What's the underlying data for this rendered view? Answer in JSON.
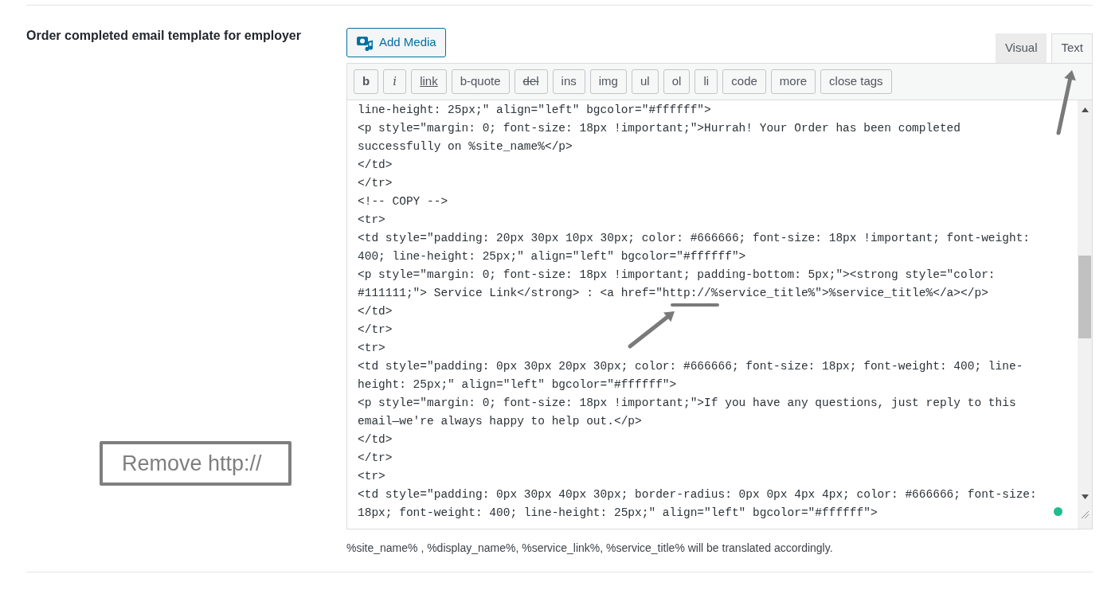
{
  "field": {
    "label": "Order completed email template for employer"
  },
  "add_media": {
    "label": "Add Media"
  },
  "tabs": [
    {
      "label": "Visual",
      "selected": false
    },
    {
      "label": "Text",
      "selected": true
    }
  ],
  "quicktags": [
    {
      "label": "b",
      "kind": "bold"
    },
    {
      "label": "i",
      "kind": "italic"
    },
    {
      "label": "link",
      "kind": "underline"
    },
    {
      "label": "b-quote",
      "kind": "plain"
    },
    {
      "label": "del",
      "kind": "strike"
    },
    {
      "label": "ins",
      "kind": "plain"
    },
    {
      "label": "img",
      "kind": "plain"
    },
    {
      "label": "ul",
      "kind": "plain"
    },
    {
      "label": "ol",
      "kind": "plain"
    },
    {
      "label": "li",
      "kind": "plain"
    },
    {
      "label": "code",
      "kind": "plain"
    },
    {
      "label": "more",
      "kind": "plain"
    },
    {
      "label": "close tags",
      "kind": "plain"
    }
  ],
  "code_lines": [
    "line-height: 25px;\" align=\"left\" bgcolor=\"#ffffff\">",
    "<p style=\"margin: 0; font-size: 18px !important;\">Hurrah! Your Order has been completed",
    "successfully on %site_name%</p>",
    "</td>",
    "</tr>",
    "<!-- COPY -->",
    "<tr>",
    "<td style=\"padding: 20px 30px 10px 30px; color: #666666; font-size: 18px !important; font-weight:",
    "400; line-height: 25px;\" align=\"left\" bgcolor=\"#ffffff\">",
    "<p style=\"margin: 0; font-size: 18px !important; padding-bottom: 5px;\"><strong style=\"color:",
    "#111111;\"> Service Link</strong> : <a href=\"http://%service_title%\">%service_title%</a></p>",
    "</td>",
    "</tr>",
    "<tr>",
    "<td style=\"padding: 0px 30px 20px 30px; color: #666666; font-size: 18px; font-weight: 400; line-",
    "height: 25px;\" align=\"left\" bgcolor=\"#ffffff\">",
    "<p style=\"margin: 0; font-size: 18px !important;\">If you have any questions, just reply to this",
    "email—we're always happy to help out.</p>",
    "</td>",
    "</tr>",
    "<tr>",
    "<td style=\"padding: 0px 30px 40px 30px; border-radius: 0px 0px 4px 4px; color: #666666; font-size:",
    "18px; font-weight: 400; line-height: 25px;\" align=\"left\" bgcolor=\"#ffffff\">"
  ],
  "hint": "%site_name% , %display_name%, %service_link%, %service_title% will be translated accordingly.",
  "annotation": {
    "label": "Remove http://"
  }
}
